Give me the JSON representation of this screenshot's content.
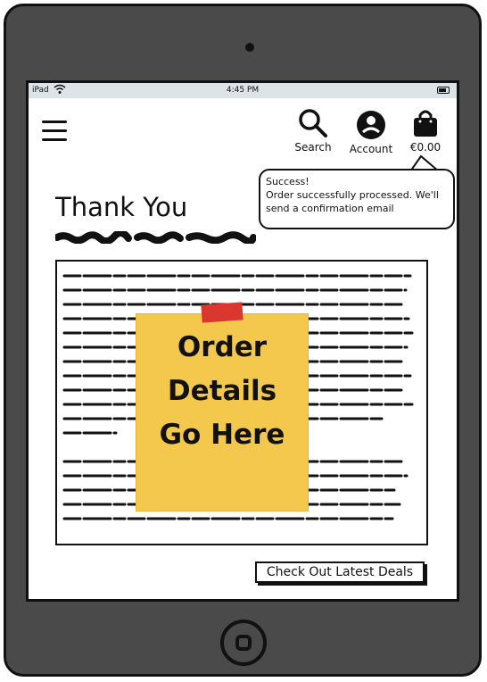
{
  "status_bar": {
    "carrier": "iPad",
    "time": "4:45 PM"
  },
  "header": {
    "search_label": "Search",
    "account_label": "Account",
    "cart_amount": "€0.00"
  },
  "toast": {
    "title": "Success!",
    "message": "Order successfully processed. We'll send a confirmation email"
  },
  "page": {
    "title": "Thank You",
    "note_line1": "Order",
    "note_line2": "Details",
    "note_line3": "Go Here",
    "deals_button": "Check Out Latest Deals"
  },
  "colors": {
    "device": "#4a4a4a",
    "status_bar": "#dde3e6",
    "sticky_note": "#f4c84c",
    "tape": "#d9372f"
  }
}
